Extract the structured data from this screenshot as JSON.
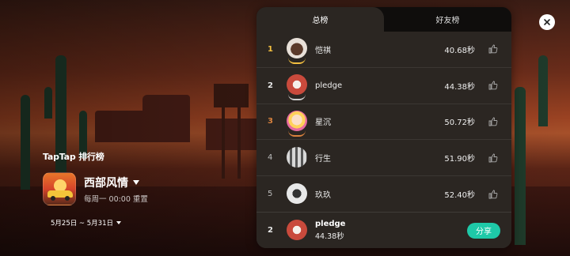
{
  "left": {
    "brand": "TapTap 排行榜",
    "game_title": "西部风情",
    "reset_text": "每周一 00:00 重置",
    "date_range": "5月25日 ~ 5月31日"
  },
  "tabs": [
    {
      "label": "总榜",
      "active": true
    },
    {
      "label": "好友榜",
      "active": false
    }
  ],
  "rows": [
    {
      "rank": "1",
      "medal": "gold",
      "name": "恺祺",
      "score": "40.68秒"
    },
    {
      "rank": "2",
      "medal": "silver",
      "name": "pledge",
      "score": "44.38秒"
    },
    {
      "rank": "3",
      "medal": "bronze",
      "name": "星沉",
      "score": "50.72秒"
    },
    {
      "rank": "4",
      "medal": "none",
      "name": "行生",
      "score": "51.90秒"
    },
    {
      "rank": "5",
      "medal": "none",
      "name": "玖玖",
      "score": "52.40秒"
    }
  ],
  "me": {
    "rank": "2",
    "name": "pledge",
    "score": "44.38秒",
    "share_label": "分享"
  },
  "colors": {
    "gold": "#f4c040",
    "silver": "#e8e8e8",
    "bronze": "#d9823e",
    "accent": "#1ec9a8",
    "panel": "#2b2622"
  },
  "icons": [
    "thumbs-up-icon",
    "close-icon",
    "chevron-down-icon"
  ]
}
